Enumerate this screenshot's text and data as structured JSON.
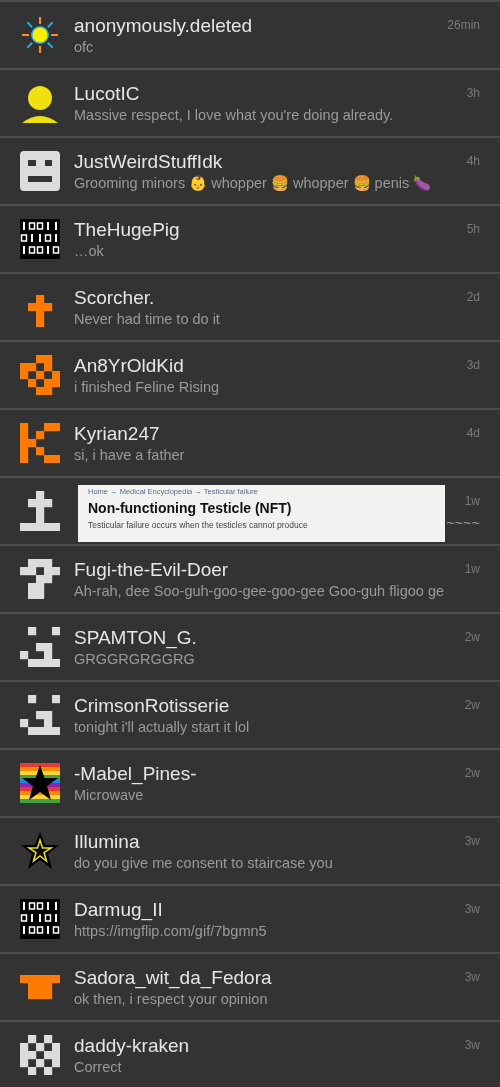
{
  "conversations": [
    {
      "name": "anonymously.deleted",
      "message": "ofc",
      "time": "26min"
    },
    {
      "name": "LucotIC",
      "message": "Massive respect, I love what you're doing already.",
      "time": "3h"
    },
    {
      "name": "JustWeirdStuffIdk",
      "message": "Grooming minors 👶 whopper 🍔 whopper 🍔 penis 🍆",
      "time": "4h"
    },
    {
      "name": "TheHugePig",
      "message": "…ok",
      "time": "5h"
    },
    {
      "name": "Scorcher.",
      "message": "Never had time to do it",
      "time": "2d"
    },
    {
      "name": "An8YrOldKid",
      "message": "i finished Feline Rising",
      "time": "3d"
    },
    {
      "name": "Kyrian247",
      "message": "si, i have a father",
      "time": "4d"
    },
    {
      "message_end": "~~~~",
      "time": "1w",
      "overlay": {
        "breadcrumb": "Home → Medical Encyclopedia → Testicular failure",
        "title": "Non-functioning Testicle (NFT)",
        "text": "Testicular failure occurs when the testicles cannot produce"
      }
    },
    {
      "name": "Fugi-the-Evil-Doer",
      "message": "Ah-rah, dee Soo-guh-goo-gee-goo-gee Goo-guh fligoo ge",
      "time": "1w"
    },
    {
      "name": "SPAMTON_G.",
      "message": "GRGGRGRGGRG",
      "time": "2w"
    },
    {
      "name": "CrimsonRotisserie",
      "message": "tonight i'll actually start it lol",
      "time": "2w"
    },
    {
      "name": "-Mabel_Pines-",
      "message": "Microwave",
      "time": "2w"
    },
    {
      "name": "Illumina",
      "message": "do you give me consent to staircase you",
      "time": "3w"
    },
    {
      "name": "Darmug_II",
      "message": "https://imgflip.com/gif/7bgmn5",
      "time": "3w"
    },
    {
      "name": "Sadora_wit_da_Fedora",
      "message": "ok then, i respect your opinion",
      "time": "3w"
    },
    {
      "name": "daddy-kraken",
      "message": "Correct",
      "time": "3w"
    }
  ]
}
